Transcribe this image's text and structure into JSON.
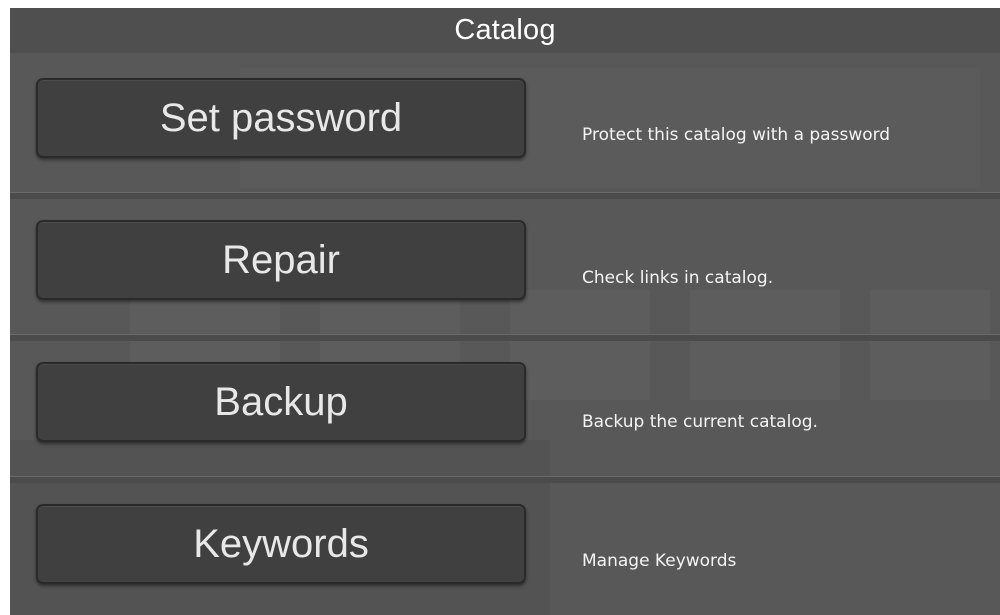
{
  "window": {
    "title": "Catalog"
  },
  "actions": [
    {
      "label": "Set password",
      "description": "Protect this catalog with a password"
    },
    {
      "label": "Repair",
      "description": "Check links in catalog."
    },
    {
      "label": "Backup",
      "description": "Backup the current catalog."
    },
    {
      "label": "Keywords",
      "description": "Manage Keywords"
    }
  ],
  "colors": {
    "panel_background": "#585858",
    "title_bar": "#4f4f4f",
    "button_background": "#404040",
    "text": "#ffffff"
  }
}
